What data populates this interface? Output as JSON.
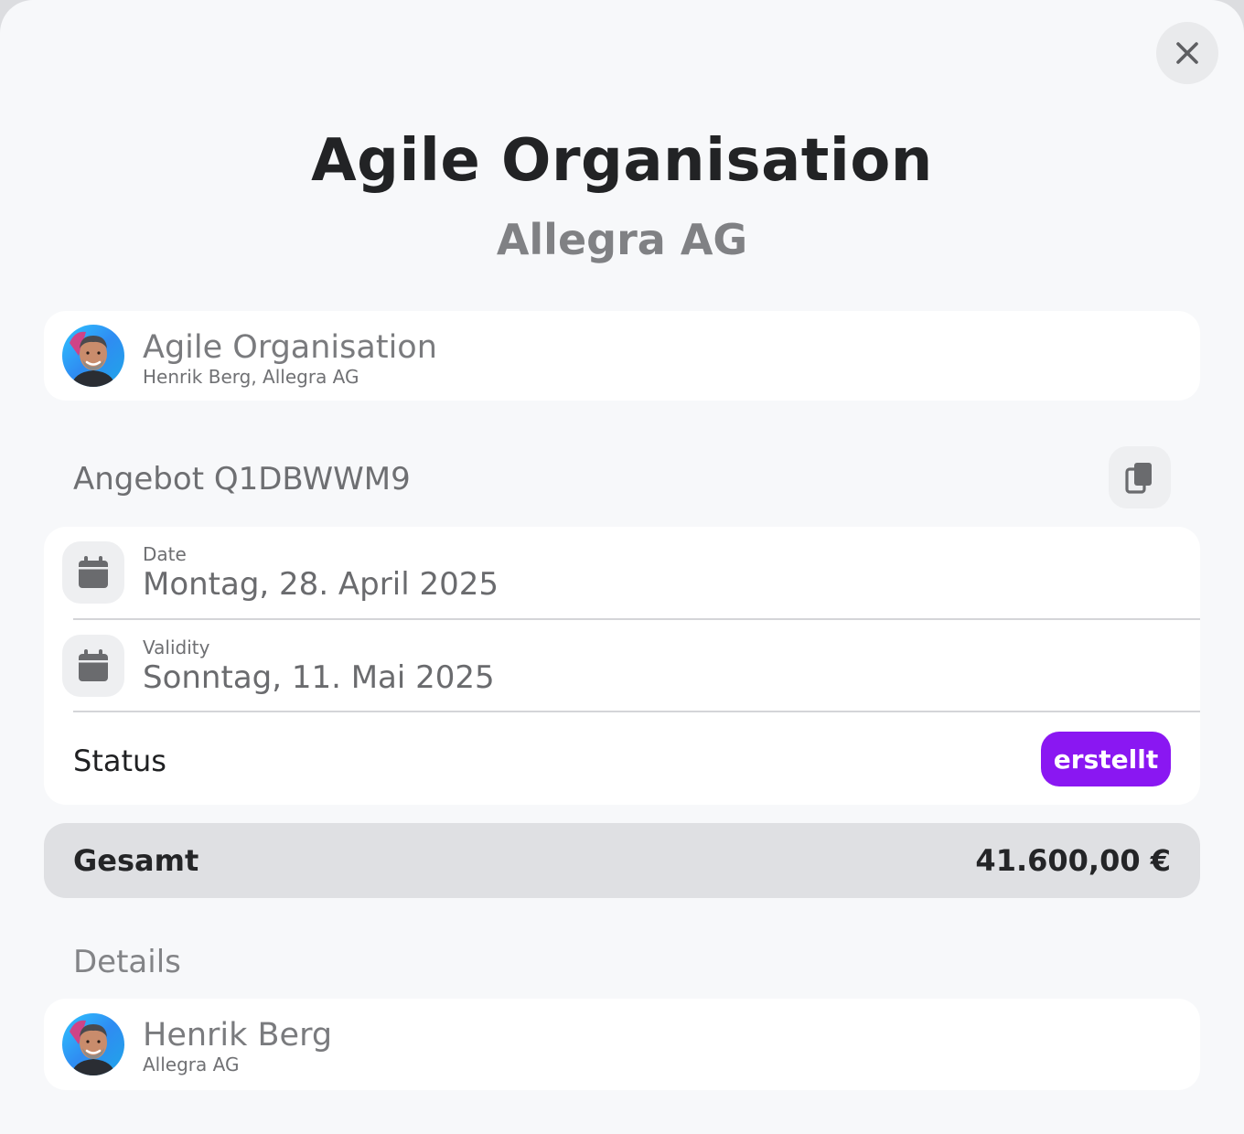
{
  "header": {
    "title": "Agile Organisation",
    "subtitle": "Allegra AG"
  },
  "contact_card": {
    "name": "Agile Organisation",
    "subtitle": "Henrik Berg, Allegra AG"
  },
  "offer": {
    "label": "Angebot Q1DBWWM9"
  },
  "date_field": {
    "label": "Date",
    "value": "Montag, 28. April 2025"
  },
  "validity_field": {
    "label": "Validity",
    "value": "Sonntag, 11. Mai 2025"
  },
  "status": {
    "label": "Status",
    "badge": "erstellt",
    "badge_color": "#8a17f2"
  },
  "total": {
    "label": "Gesamt",
    "value": "41.600,00 €"
  },
  "details": {
    "label": "Details",
    "person": {
      "name": "Henrik Berg",
      "company": "Allegra AG"
    }
  },
  "icons": {
    "close": "close-icon",
    "copy": "copy-icon",
    "calendar": "calendar-icon",
    "avatar": "avatar"
  }
}
